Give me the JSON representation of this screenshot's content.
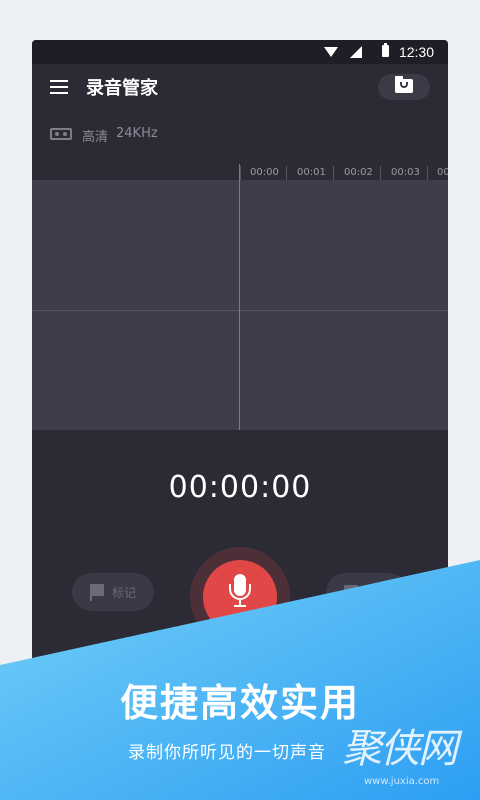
{
  "status_bar": {
    "time": "12:30"
  },
  "app_bar": {
    "title": "录音管家"
  },
  "recording_info": {
    "quality_label": "高清",
    "sample_rate": "24KHz"
  },
  "timeline": {
    "labels": [
      "00:00",
      "00:01",
      "00:02",
      "00:03",
      "00"
    ]
  },
  "timer": {
    "value": "00:00:00"
  },
  "controls": {
    "mark_label": "标记"
  },
  "promo": {
    "title": "便捷高效实用",
    "subtitle": "录制你所听见的一切声音",
    "watermark_logo": "聚侠网",
    "watermark_url": "www.juxia.com"
  },
  "colors": {
    "background": "#2b2a35",
    "record": "#e24747",
    "accent_blue": "#3aa8f4",
    "playhead": "#d9545a"
  }
}
